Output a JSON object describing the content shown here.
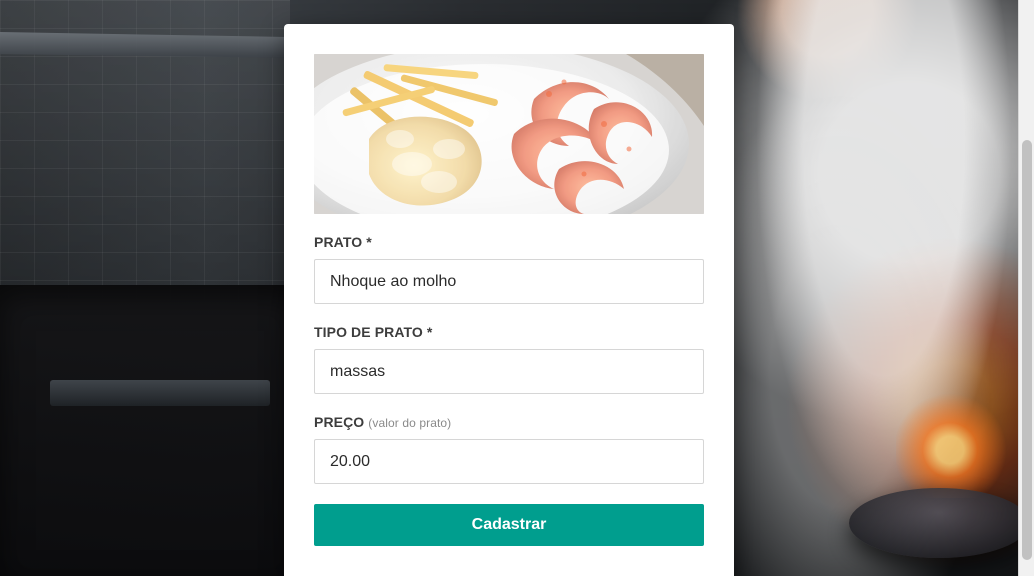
{
  "modal": {
    "image": {
      "alt": "Nhoque ao molho"
    },
    "fields": [
      {
        "label": "PRATO",
        "required_marker": "*",
        "value": "Nhoque ao molho"
      },
      {
        "label": "TIPO DE PRATO",
        "required_marker": "*",
        "value": "massas"
      },
      {
        "label": "PREÇO",
        "hint": "(valor do prato)",
        "value": "20.00"
      }
    ],
    "submit_label": "Cadastrar"
  },
  "colors": {
    "button": "#009e8e",
    "label_text": "#3d3d3d",
    "input_border": "#d6d6d6"
  }
}
